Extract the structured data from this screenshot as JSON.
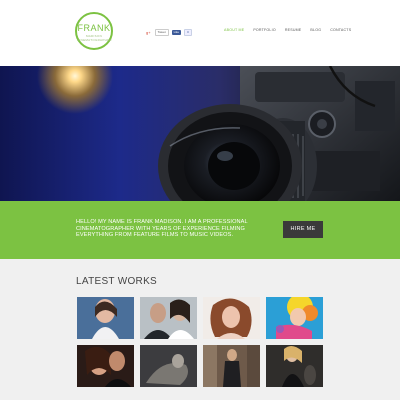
{
  "logo": {
    "title": "FRANK",
    "subtitle": "MADISON CINEMATOGRAPHER"
  },
  "social": {
    "gplus": "g+",
    "tweet": "Tweet",
    "like": "Like",
    "like_count": "0"
  },
  "nav": {
    "items": [
      {
        "label": "ABOUT ME",
        "active": true
      },
      {
        "label": "PORTFOLIO",
        "active": false
      },
      {
        "label": "RESUME",
        "active": false
      },
      {
        "label": "BLOG",
        "active": false
      },
      {
        "label": "CONTACTS",
        "active": false
      }
    ]
  },
  "banner": {
    "text": "HELLO! MY NAME IS FRANK MADISON. I AM A PROFESSIONAL CINEMATOGRAPHER WITH YEARS OF EXPERIENCE FILMING EVERYTHING FROM FEATURE FILMS TO MUSIC VIDEOS.",
    "button_label": "HIRE ME"
  },
  "works": {
    "title": "LATEST WORKS"
  },
  "colors": {
    "accent": "#7cc242",
    "dark_button": "#3a3a3a",
    "works_bg": "#f0f0f0"
  }
}
